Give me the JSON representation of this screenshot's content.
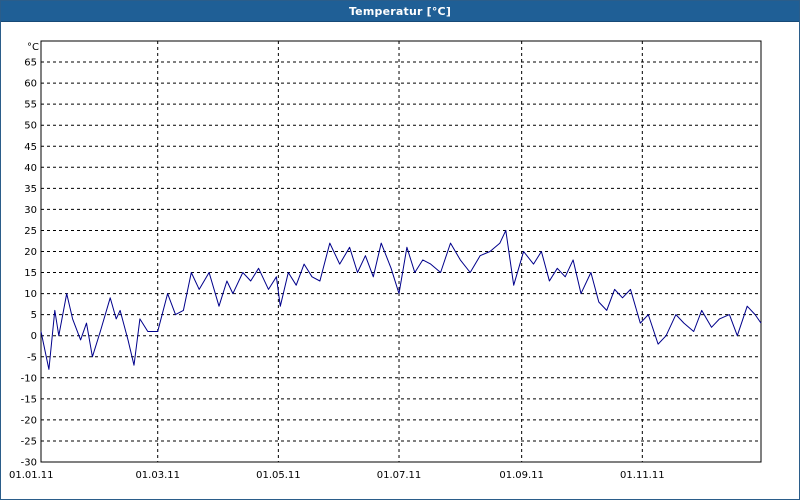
{
  "window": {
    "title": "Temperatur [°C]"
  },
  "chart_data": {
    "type": "line",
    "title": "Temperatur [°C]",
    "ylabel": "°C",
    "xlabel": "",
    "ylim": [
      -30,
      70
    ],
    "yticks": [
      65,
      60,
      55,
      50,
      45,
      40,
      35,
      30,
      25,
      20,
      15,
      10,
      5,
      0,
      -5,
      -10,
      -15,
      -20,
      -25,
      -30
    ],
    "xlim": [
      "2011-01-01",
      "2011-12-31"
    ],
    "xticks": [
      {
        "date": "2011-01-01",
        "label": "01.01.11"
      },
      {
        "date": "2011-03-01",
        "label": "01.03.11"
      },
      {
        "date": "2011-05-01",
        "label": "01.05.11"
      },
      {
        "date": "2011-07-01",
        "label": "01.07.11"
      },
      {
        "date": "2011-09-01",
        "label": "01.09.11"
      },
      {
        "date": "2011-11-01",
        "label": "01.11.11"
      }
    ],
    "grid": true,
    "series": [
      {
        "color": "#00008b",
        "x": [
          "2011-01-01",
          "2011-01-05",
          "2011-01-08",
          "2011-01-10",
          "2011-01-14",
          "2011-01-17",
          "2011-01-21",
          "2011-01-24",
          "2011-01-27",
          "2011-01-31",
          "2011-02-05",
          "2011-02-08",
          "2011-02-10",
          "2011-02-14",
          "2011-02-17",
          "2011-02-20",
          "2011-02-24",
          "2011-03-01",
          "2011-03-06",
          "2011-03-10",
          "2011-03-14",
          "2011-03-18",
          "2011-03-22",
          "2011-03-27",
          "2011-04-01",
          "2011-04-05",
          "2011-04-08",
          "2011-04-13",
          "2011-04-17",
          "2011-04-21",
          "2011-04-26",
          "2011-04-30",
          "2011-05-02",
          "2011-05-06",
          "2011-05-10",
          "2011-05-14",
          "2011-05-18",
          "2011-05-22",
          "2011-05-27",
          "2011-06-01",
          "2011-06-06",
          "2011-06-10",
          "2011-06-14",
          "2011-06-18",
          "2011-06-22",
          "2011-06-27",
          "2011-07-01",
          "2011-07-05",
          "2011-07-09",
          "2011-07-13",
          "2011-07-17",
          "2011-07-22",
          "2011-07-27",
          "2011-08-01",
          "2011-08-06",
          "2011-08-11",
          "2011-08-16",
          "2011-08-21",
          "2011-08-24",
          "2011-08-28",
          "2011-09-02",
          "2011-09-07",
          "2011-09-11",
          "2011-09-15",
          "2011-09-19",
          "2011-09-23",
          "2011-09-27",
          "2011-10-01",
          "2011-10-06",
          "2011-10-10",
          "2011-10-14",
          "2011-10-18",
          "2011-10-22",
          "2011-10-26",
          "2011-10-31",
          "2011-11-04",
          "2011-11-09",
          "2011-11-13",
          "2011-11-18",
          "2011-11-22",
          "2011-11-27",
          "2011-12-01",
          "2011-12-06",
          "2011-12-10",
          "2011-12-15",
          "2011-12-19",
          "2011-12-24",
          "2011-12-28",
          "2011-12-31"
        ],
        "values": [
          1,
          -8,
          6,
          0,
          10,
          4,
          -1,
          3,
          -5,
          1,
          9,
          4,
          6,
          -1,
          -7,
          4,
          1,
          1,
          10,
          5,
          6,
          15,
          11,
          15,
          7,
          13,
          10,
          15,
          13,
          16,
          11,
          14,
          7,
          15,
          12,
          17,
          14,
          13,
          22,
          17,
          21,
          15,
          19,
          14,
          22,
          16,
          10,
          21,
          15,
          18,
          17,
          15,
          22,
          18,
          15,
          19,
          20,
          22,
          25,
          12,
          20,
          17,
          20,
          13,
          16,
          14,
          18,
          10,
          15,
          8,
          6,
          11,
          9,
          11,
          3,
          5,
          -2,
          0,
          5,
          3,
          1,
          6,
          2,
          4,
          5,
          0,
          7,
          5,
          3
        ]
      }
    ]
  }
}
